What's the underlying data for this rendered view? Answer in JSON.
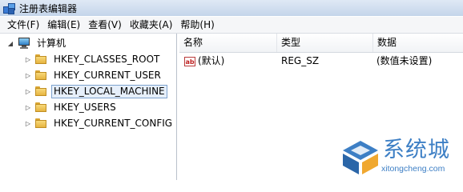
{
  "window": {
    "title": "注册表编辑器"
  },
  "menu": {
    "items": [
      "文件(F)",
      "编辑(E)",
      "查看(V)",
      "收藏夹(A)",
      "帮助(H)"
    ]
  },
  "tree": {
    "root": "计算机",
    "items": [
      {
        "label": "HKEY_CLASSES_ROOT"
      },
      {
        "label": "HKEY_CURRENT_USER"
      },
      {
        "label": "HKEY_LOCAL_MACHINE",
        "selected": true
      },
      {
        "label": "HKEY_USERS"
      },
      {
        "label": "HKEY_CURRENT_CONFIG"
      }
    ]
  },
  "list": {
    "columns": [
      "名称",
      "类型",
      "数据"
    ],
    "rows": [
      {
        "name": "(默认)",
        "type": "REG_SZ",
        "data": "(数值未设置)",
        "icon": "ab"
      }
    ]
  },
  "watermark": {
    "brand": "系统城",
    "url": "xitongcheng.com"
  },
  "colors": {
    "accent": "#3d7fc5",
    "selection": "#e6effa",
    "folder": "#e6b440"
  }
}
